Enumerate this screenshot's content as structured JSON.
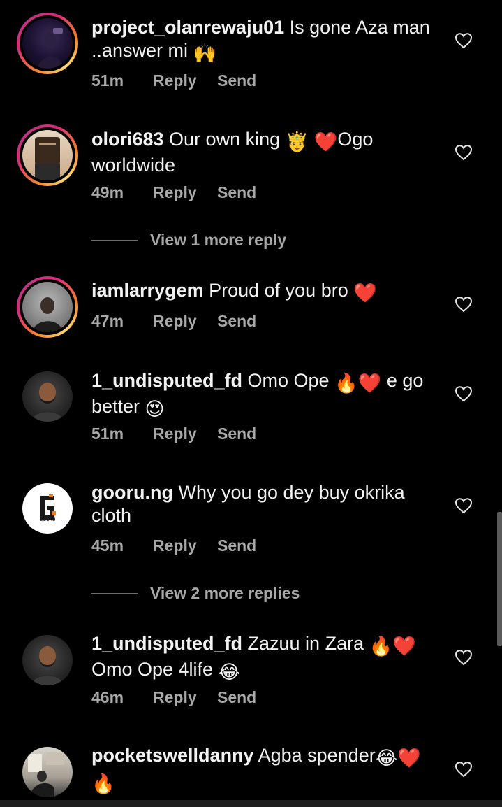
{
  "comments": [
    {
      "username": "project_olanrewaju01",
      "text": " Is gone Aza man ..answer mi ",
      "emoji": "🙌",
      "time": "51m",
      "reply": "Reply",
      "send": "Send",
      "avatar_icon": "avatar-dark-purple"
    },
    {
      "username": "olori683",
      "text": " Our own king ",
      "text2": "Ogo worldwide",
      "emoji": "🤴",
      "emoji2": "❤️",
      "time": "49m",
      "reply": "Reply",
      "send": "Send",
      "avatar_icon": "avatar-brown-shirt"
    },
    {
      "username": "iamlarrygem",
      "text": " Proud of you bro ",
      "emoji": "❤️",
      "time": "47m",
      "reply": "Reply",
      "send": "Send",
      "avatar_icon": "avatar-man-grey-bg"
    },
    {
      "username": "1_undisputed_fd",
      "text": " Omo Ope ",
      "emoji": "🔥",
      "emoji2": "❤️",
      "text2": " e go better ",
      "emoji3": "😍",
      "time": "51m",
      "reply": "Reply",
      "send": "Send",
      "avatar_icon": "avatar-bearded-man"
    },
    {
      "username": "gooru.ng",
      "text": " Why you go dey buy okrika cloth",
      "time": "45m",
      "reply": "Reply",
      "send": "Send",
      "avatar_icon": "gooru-logo",
      "logo_text": "GOORU"
    },
    {
      "username": "1_undisputed_fd",
      "text": " Zazuu in Zara ",
      "emoji": "🔥",
      "emoji2": "❤️",
      "text2": "Omo Ope 4life ",
      "emoji3": "😂",
      "time": "46m",
      "reply": "Reply",
      "send": "Send",
      "avatar_icon": "avatar-bearded-man"
    },
    {
      "username": "pocketswelldanny",
      "text": " Agba spender",
      "emoji": "😂",
      "emoji2": "❤️",
      "emoji3": "🔥",
      "avatar_icon": "avatar-room-photo"
    }
  ],
  "view_more": [
    {
      "label": "View 1 more reply"
    },
    {
      "label": "View 2 more replies"
    }
  ],
  "colors": {
    "background": "#000000",
    "text": "#f2f2f2",
    "meta": "#a8a8a8",
    "ring_gradient": [
      "#f58529",
      "#dd2a7b",
      "#c13584",
      "#feda75"
    ]
  },
  "icons": {
    "like": "heart-outline-icon"
  }
}
